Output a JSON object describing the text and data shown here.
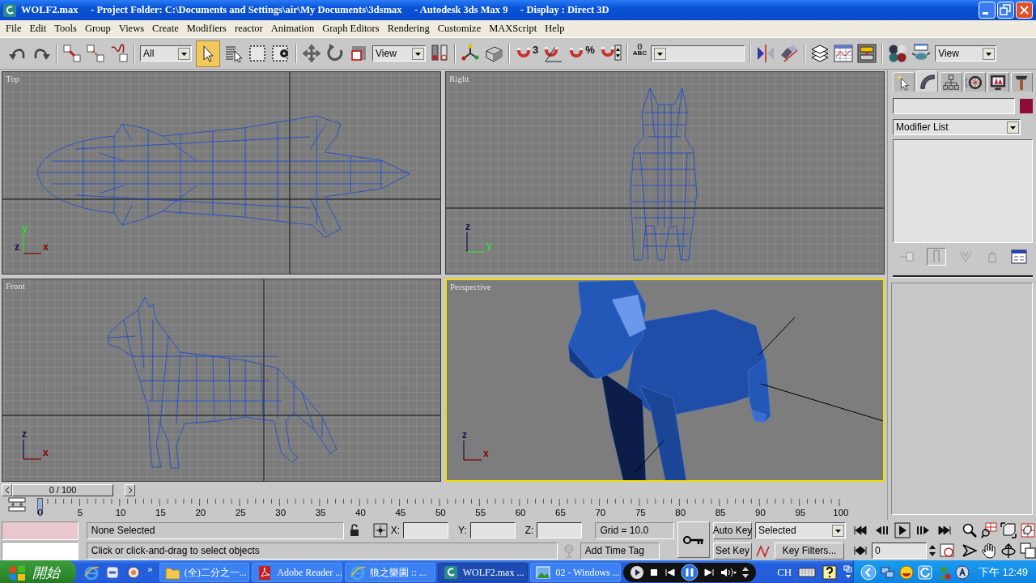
{
  "window": {
    "title": "WOLF2.max     - Project Folder: C:\\Documents and Settings\\air\\My Documents\\3dsmax     - Autodesk 3ds Max 9     - Display : Direct 3D"
  },
  "menu": [
    "File",
    "Edit",
    "Tools",
    "Group",
    "Views",
    "Create",
    "Modifiers",
    "reactor",
    "Animation",
    "Graph Editors",
    "Rendering",
    "Customize",
    "MAXScript",
    "Help"
  ],
  "toolbar": {
    "selection_filter": "All",
    "select_object_active": true,
    "reference_coord_system": "View",
    "snap_mark": "3",
    "percent_snap_mark": "%",
    "named_selection_marks": [
      "{}",
      "ABC"
    ],
    "render_preset": "View"
  },
  "viewports": [
    {
      "label": "Top",
      "kind": "ortho",
      "active": false,
      "axes": [
        {
          "label": "y",
          "kind": "up",
          "color": "#30e030"
        },
        {
          "label": "z",
          "kind": "origin",
          "color": "#101050"
        },
        {
          "label": "x",
          "kind": "right",
          "color": "#800000"
        }
      ]
    },
    {
      "label": "Right",
      "kind": "ortho",
      "active": false,
      "axes": [
        {
          "label": "z",
          "kind": "up",
          "color": "#101050"
        },
        {
          "label": "y",
          "kind": "right",
          "color": "#30e030"
        }
      ]
    },
    {
      "label": "Front",
      "kind": "ortho",
      "active": false,
      "axes": [
        {
          "label": "z",
          "kind": "up",
          "color": "#101050"
        },
        {
          "label": "x",
          "kind": "right",
          "color": "#800000"
        }
      ]
    },
    {
      "label": "Perspective",
      "kind": "perspective",
      "active": true,
      "axes": [
        {
          "label": "z",
          "kind": "up",
          "color": "#101050"
        },
        {
          "label": "x",
          "kind": "right",
          "color": "#800000"
        }
      ]
    }
  ],
  "command_panel": {
    "tabs": [
      {
        "selected": false
      },
      {
        "selected": true
      },
      {
        "selected": false
      },
      {
        "selected": false
      },
      {
        "selected": false
      },
      {
        "selected": false
      }
    ],
    "object_swatch": {
      "color": "#8c0c35"
    },
    "modifier_list": "Modifier List"
  },
  "time_slider": {
    "label": "0 / 100",
    "level": 0
  },
  "track_bar": {
    "ticks": [
      "0",
      "5",
      "10",
      "15",
      "20",
      "25",
      "30",
      "35",
      "40",
      "45",
      "50",
      "55",
      "60",
      "65",
      "70",
      "75",
      "80",
      "85",
      "90",
      "95",
      "100"
    ]
  },
  "status": {
    "selection": "None Selected",
    "x_label": "X:",
    "y_label": "Y:",
    "z_label": "Z:",
    "grid": "Grid = 10.0",
    "prompt": "Click or click-and-drag to select objects",
    "time_tag": "Add Time Tag",
    "auto_key": "Auto Key",
    "set_key": "Set Key",
    "key_set": "Selected",
    "key_filters": "Key Filters...",
    "current_frame": "0"
  },
  "taskbar": {
    "start": "開始",
    "overflow": "»",
    "buttons": [
      {
        "label": "(全)二分之一...",
        "selected": false
      },
      {
        "label": "Adobe Reader ...",
        "selected": false
      },
      {
        "label": "狼之樂園 :: ...",
        "selected": false
      },
      {
        "label": "WOLF2.max ...",
        "selected": true
      },
      {
        "label": "02 - Windows ...",
        "selected": false
      }
    ],
    "language": "CH",
    "clock": "下午 12:49"
  }
}
